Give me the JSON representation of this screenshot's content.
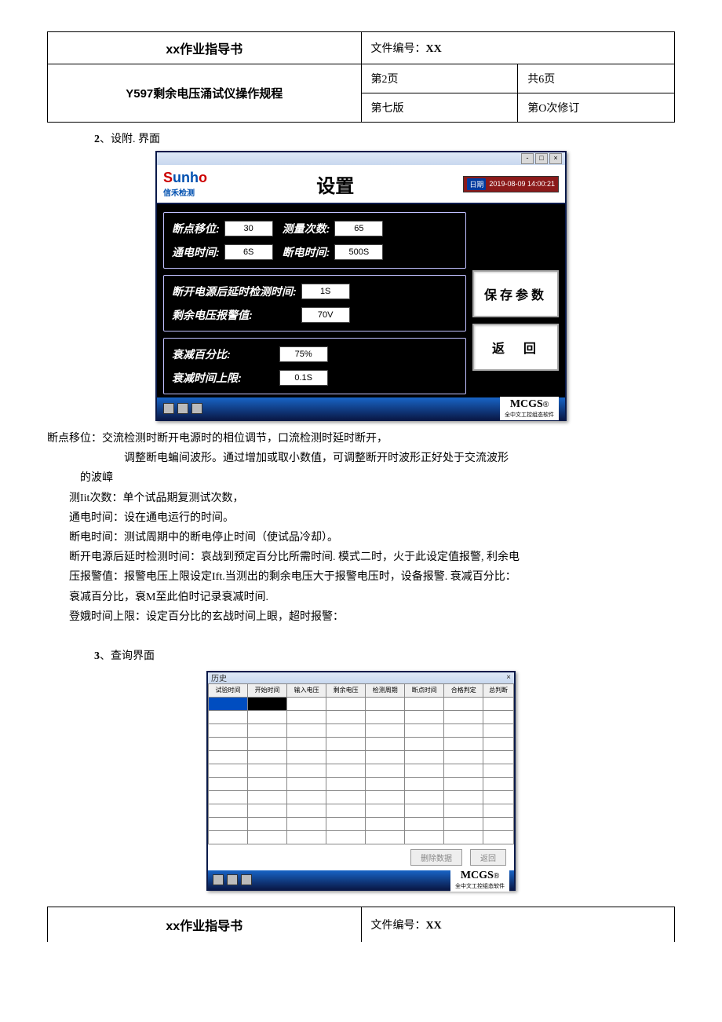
{
  "header": {
    "title": "xx作业指导书",
    "doc_no_label": "文件编号：",
    "doc_no_value": "XX",
    "subtitle": "Y597剩余电压涌试仪操作规程",
    "page_label_l": "第2页",
    "page_label_r": "共6页",
    "edition": "第七版",
    "revision": "第O次修订"
  },
  "section2": {
    "heading": "2、设附. 界面",
    "logo_main": "Sunho",
    "logo_sub": "信禾检测",
    "window_title": "设置",
    "date_lbl": "日期",
    "date_val": "2019-08-09 14:00:21",
    "labels": {
      "offset": "断点移位:",
      "offset_val": "30",
      "count": "测量次数:",
      "count_val": "65",
      "on_time": "通电时间:",
      "on_time_val": "6S",
      "off_time": "断电时间:",
      "off_time_val": "500S",
      "delay": "断开电源后延时检测时间:",
      "delay_val": "1S",
      "alarm": "剩余电压报警值:",
      "alarm_val": "70V",
      "decay_pct": "衰减百分比:",
      "decay_pct_val": "75%",
      "decay_limit": "衰减时间上限:",
      "decay_limit_val": "0.1S"
    },
    "btn_save": "保存参数",
    "btn_back": "返　回",
    "mcgs": "MCGS",
    "mcgs_sub": "全中文工控组态软件"
  },
  "explain": {
    "l1": "断点移位：交流检测时断开电源时的相位调节，口流检测时延时断开，",
    "l2": "调整断电蝙间波形。通过增加或取小数值，可调整断开时波形正好处于交流波形",
    "l3": "的波嶂",
    "l4": "测Iit次数：单个试品期复测试次数，",
    "l5": "通电时间：设在通电运行的时间。",
    "l6": "断电时间：测试周期中的断电停止时间（使试品冷却）。",
    "l7": "断开电源后延时检测时间：哀战到预定百分比所需时间. 模式二时，火于此设定值报警, 利余电",
    "l8": "压报警值：报警电压上限设定Ift.当测出的剩余电压大于报警电压时，设备报警. 衰减百分比：",
    "l9": "衰减百分比，衰M至此伯时记录衰减时间.",
    "l10": "登娥时间上限：设定百分比的玄战时间上眼，超时报警：",
    "section3_heading": "3、查询界面"
  },
  "query": {
    "title": "历史",
    "col1": "试验时间",
    "col2": "开始时间",
    "col3": "输入电压",
    "col4": "剩余电压",
    "col5": "检测周期",
    "col6": "断点时间",
    "col7": "合格判定",
    "col8": "总判断",
    "btn_del": "删除数据",
    "btn_back": "返回",
    "mcgs": "MCGS",
    "mcgs_sub": "全中文工控组态软件"
  },
  "footer": {
    "title": "xx作业指导书",
    "doc_no_label": "文件编号：",
    "doc_no_value": "XX"
  }
}
